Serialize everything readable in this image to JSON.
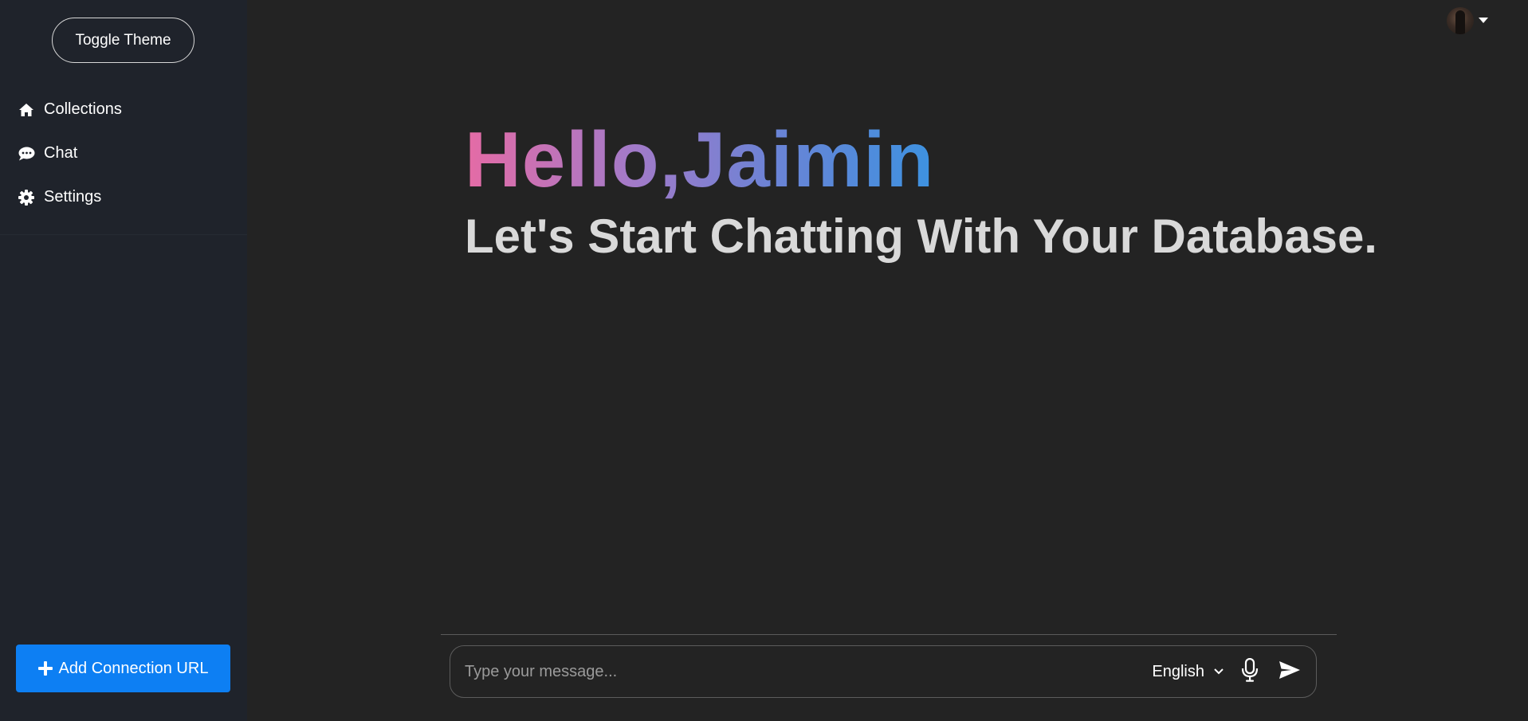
{
  "sidebar": {
    "toggle_theme_label": "Toggle Theme",
    "items": [
      {
        "label": "Collections",
        "icon": "home-icon"
      },
      {
        "label": "Chat",
        "icon": "comment-icon"
      },
      {
        "label": "Settings",
        "icon": "gear-icon"
      }
    ],
    "add_connection_label": "Add Connection URL"
  },
  "header": {
    "avatar": "user-avatar",
    "menu_icon": "caret-down-icon"
  },
  "main": {
    "greeting": "Hello,Jaimin",
    "subtitle": "Let's Start Chatting With Your Database."
  },
  "composer": {
    "placeholder": "Type your message...",
    "value": "",
    "language": "English",
    "mic_icon": "microphone-icon",
    "send_icon": "send-icon"
  },
  "colors": {
    "background": "#232323",
    "sidebar": "#1f232b",
    "accent": "#0d7ff3",
    "gradient_start": "#e56ba5",
    "gradient_end": "#3d92e0"
  }
}
